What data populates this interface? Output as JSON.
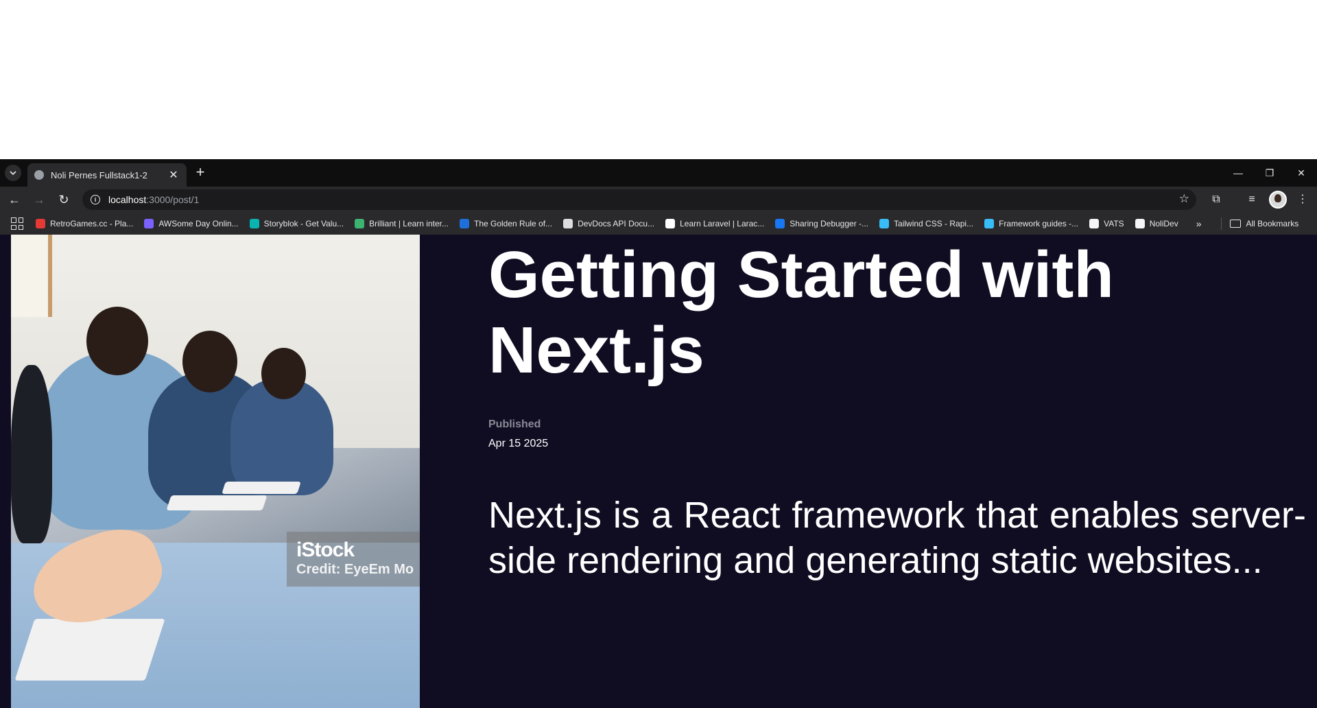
{
  "browser": {
    "tab": {
      "title": "Noli Pernes Fullstack1-2"
    },
    "address": {
      "host": "localhost",
      "path": ":3000/post/1"
    },
    "bookmarks": [
      {
        "label": "RetroGames.cc - Pla...",
        "color": "#e53935"
      },
      {
        "label": "AWSome Day Onlin...",
        "color": "#7b61ff"
      },
      {
        "label": "Storyblok - Get Valu...",
        "color": "#09b3af"
      },
      {
        "label": "Brilliant | Learn inter...",
        "color": "#3cb371"
      },
      {
        "label": "The Golden Rule of...",
        "color": "#1e6fd9"
      },
      {
        "label": "DevDocs API Docu...",
        "color": "#dddddd"
      },
      {
        "label": "Learn Laravel | Larac...",
        "color": "#ffffff"
      },
      {
        "label": "Sharing Debugger -...",
        "color": "#1877f2"
      },
      {
        "label": "Tailwind CSS - Rapi...",
        "color": "#38bdf8"
      },
      {
        "label": "Framework guides -...",
        "color": "#38bdf8"
      },
      {
        "label": "VATS",
        "color": "#f5f5f5"
      },
      {
        "label": "NoliDev",
        "color": "#f5f5f5"
      }
    ],
    "all_bookmarks": "All Bookmarks"
  },
  "post": {
    "title": "Getting Started with Next.js",
    "published_label": "Published",
    "published_date": "Apr 15 2025",
    "excerpt": "Next.js is a React framework that enables server-side rendering and generating static websites...",
    "image": {
      "watermark_brand": "iStock",
      "watermark_credit": "Credit: EyeEm Mo"
    }
  }
}
